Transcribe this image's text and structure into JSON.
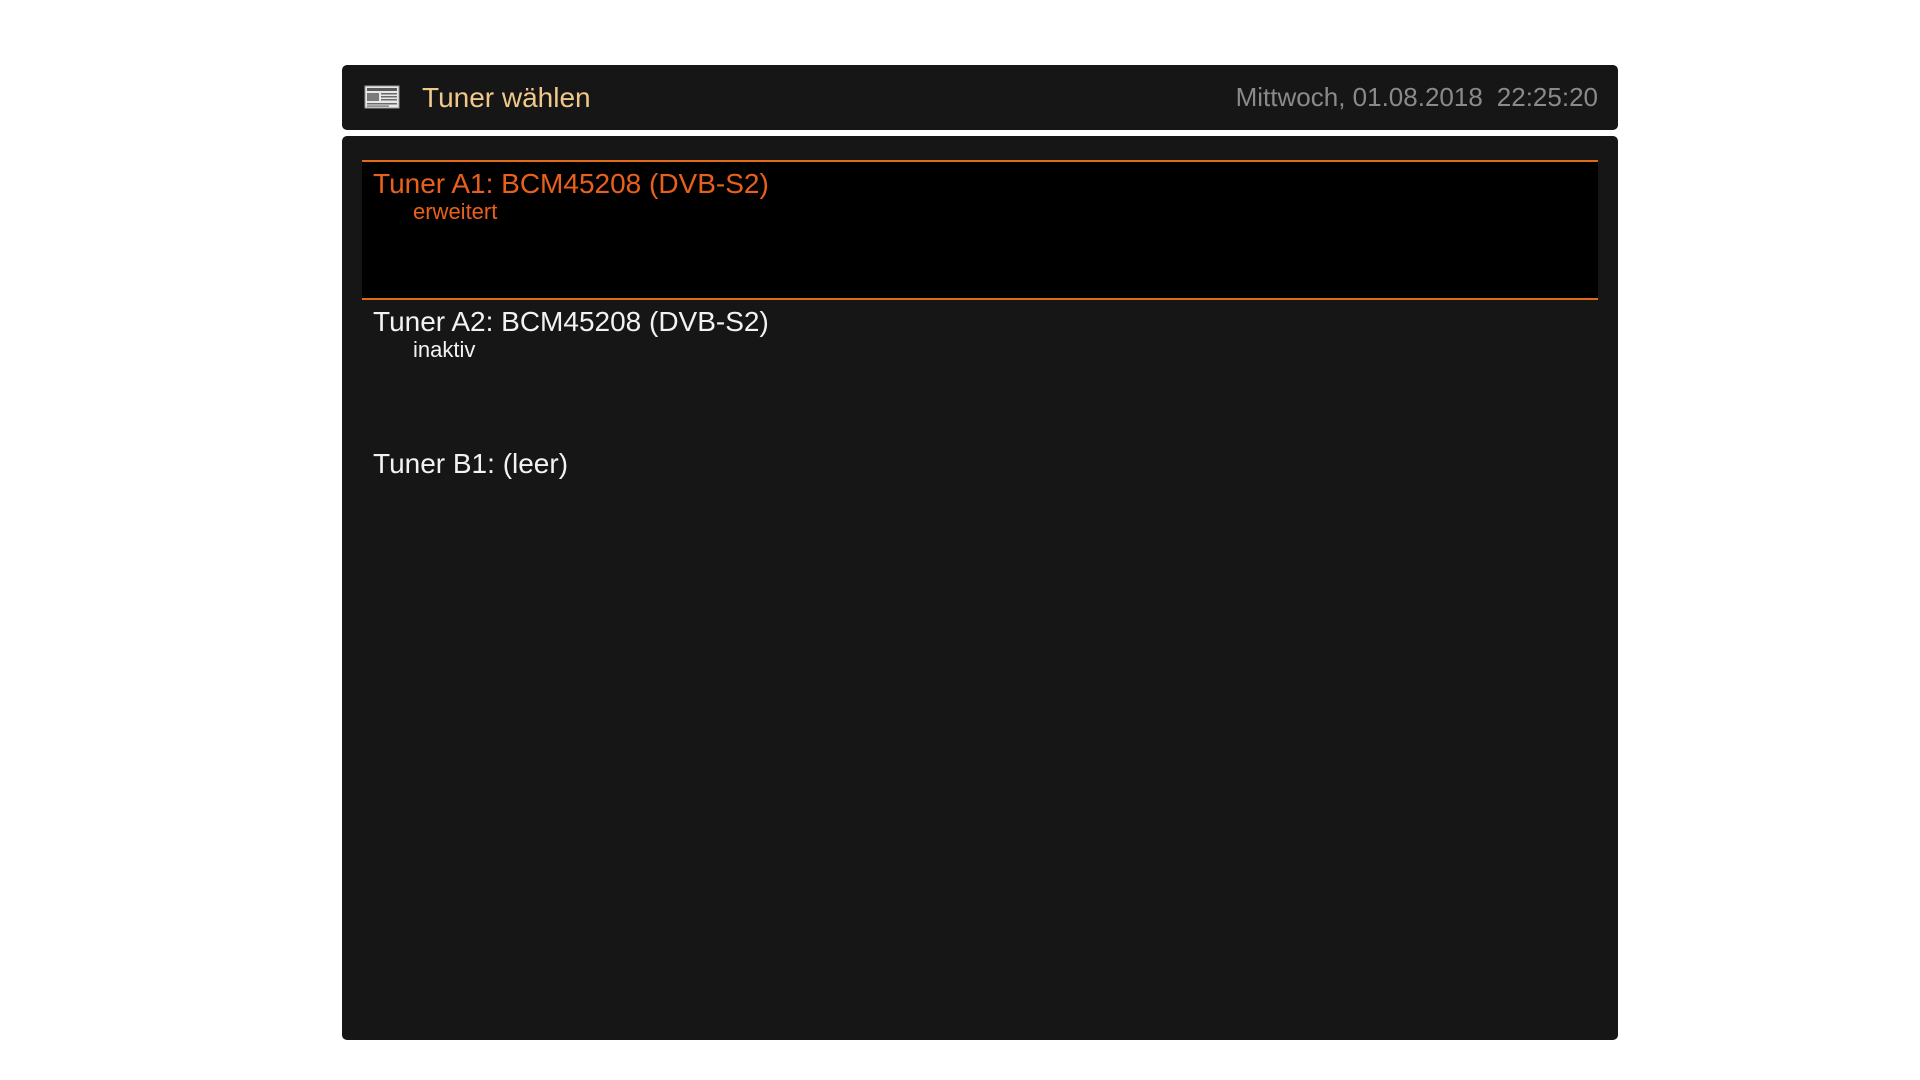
{
  "header": {
    "title": "Tuner wählen",
    "icon": "newspaper-icon",
    "date": "Mittwoch, 01.08.2018",
    "time": "22:25:20"
  },
  "colors": {
    "accent": "#e8601c",
    "selection_border": "#e36a1a",
    "title": "#f0c98a",
    "datetime": "#8a8a8a",
    "panel": "#161616"
  },
  "tuners": [
    {
      "name": "Tuner A1: BCM45208 (DVB-S2)",
      "status": "erweitert",
      "selected": true
    },
    {
      "name": "Tuner A2: BCM45208 (DVB-S2)",
      "status": "inaktiv",
      "selected": false
    },
    {
      "name": "Tuner B1: (leer)",
      "status": "",
      "selected": false
    }
  ]
}
